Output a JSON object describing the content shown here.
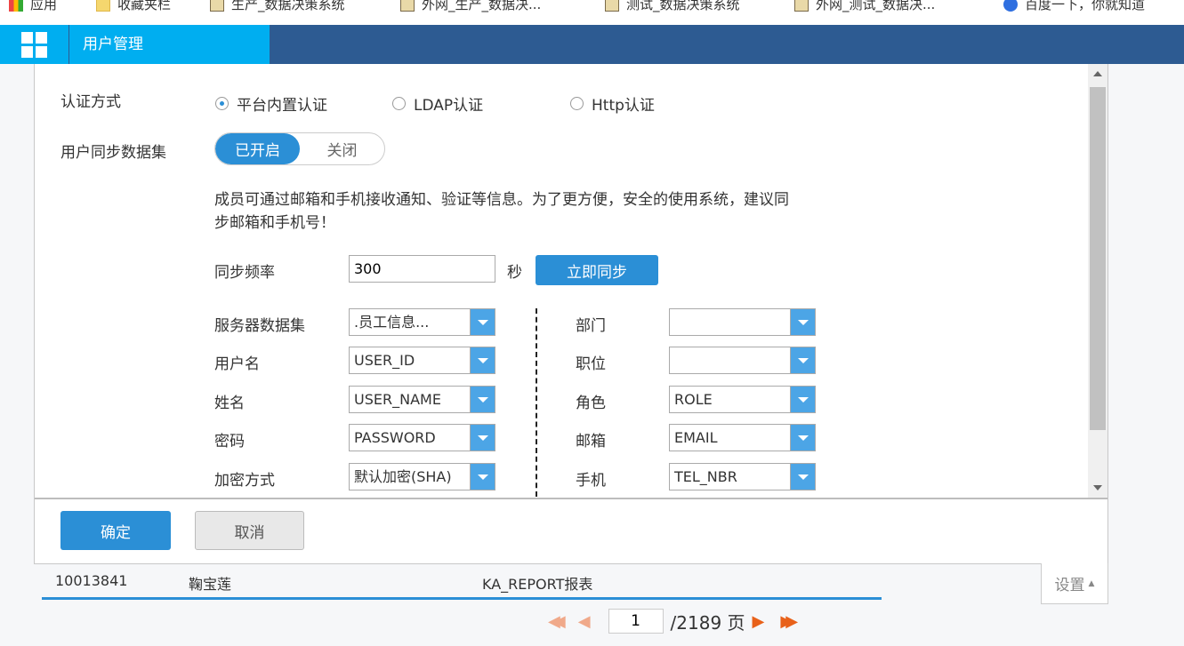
{
  "bookmarks": [
    "应用",
    "收藏夹栏",
    "生产_数据决策系统",
    "外网_生产_数据决...",
    "测试_数据决策系统",
    "外网_测试_数据决...",
    "百度一下，你就知道"
  ],
  "header": {
    "tab": "用户管理"
  },
  "form": {
    "auth_label": "认证方式",
    "auth_options": [
      {
        "label": "平台内置认证",
        "selected": true
      },
      {
        "label": "LDAP认证",
        "selected": false
      },
      {
        "label": "Http认证",
        "selected": false
      }
    ],
    "sync_label": "用户同步数据集",
    "toggle_on": "已开启",
    "toggle_off": "关闭",
    "notice": "成员可通过邮箱和手机接收通知、验证等信息。为了更方便，安全的使用系统，建议同步邮箱和手机号！",
    "freq_label": "同步频率",
    "freq_value": "300",
    "freq_unit": "秒",
    "sync_now": "立即同步",
    "left_fields": [
      {
        "label": "服务器数据集",
        "value": ".员工信息..."
      },
      {
        "label": "用户名",
        "value": "USER_ID"
      },
      {
        "label": "姓名",
        "value": "USER_NAME"
      },
      {
        "label": "密码",
        "value": "PASSWORD"
      },
      {
        "label": "加密方式",
        "value": "默认加密(SHA)"
      }
    ],
    "right_fields": [
      {
        "label": "部门",
        "value": ""
      },
      {
        "label": "职位",
        "value": ""
      },
      {
        "label": "角色",
        "value": "ROLE"
      },
      {
        "label": "邮箱",
        "value": "EMAIL"
      },
      {
        "label": "手机",
        "value": "TEL_NBR"
      }
    ]
  },
  "footer": {
    "ok": "确定",
    "cancel": "取消"
  },
  "table_row": {
    "id": "10013841",
    "name": "鞠宝莲",
    "role": "KA_REPORT报表"
  },
  "settings": "设置",
  "pagination": {
    "current": "1",
    "total": "/2189 页"
  }
}
